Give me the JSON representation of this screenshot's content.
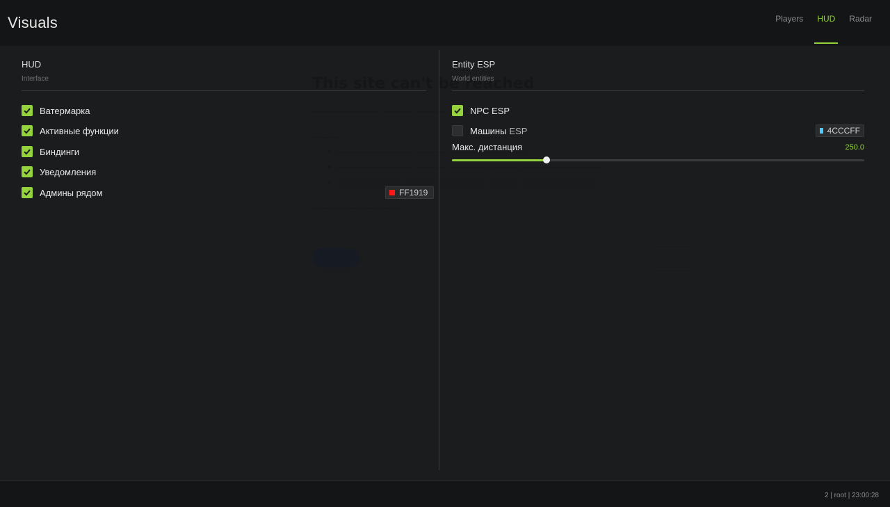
{
  "header": {
    "title": "Visuals",
    "tabs": [
      {
        "label": "Players",
        "active": false
      },
      {
        "label": "HUD",
        "active": true
      },
      {
        "label": "Radar",
        "active": false
      }
    ]
  },
  "left": {
    "title": "HUD",
    "subtitle": "Interface",
    "items": [
      {
        "label": "Ватермарка",
        "checked": true
      },
      {
        "label": "Активные функции",
        "checked": true
      },
      {
        "label": "Биндинги",
        "checked": true
      },
      {
        "label": "Уведомления",
        "checked": true
      },
      {
        "label": "Админы рядом",
        "checked": true
      }
    ],
    "admin_color": {
      "hex": "FF1919",
      "color": "#FF1919"
    }
  },
  "right": {
    "title": "Entity ESP",
    "subtitle": "World entities",
    "items": [
      {
        "label": "NPC ESP",
        "suffix": "",
        "checked": true
      },
      {
        "label": "Машины",
        "suffix": "ESP",
        "checked": false
      }
    ],
    "vehicle_color": {
      "hex": "4CCCFF",
      "color": "#4CCCFF"
    },
    "slider": {
      "label": "Макс. дистанция",
      "value": "250.0",
      "fraction": 0.23
    }
  },
  "footer": {
    "status": "2 | root | 23:00:28"
  },
  "colors": {
    "accent": "#95d33c",
    "background": "#1b1c1e",
    "header": "#141516"
  }
}
